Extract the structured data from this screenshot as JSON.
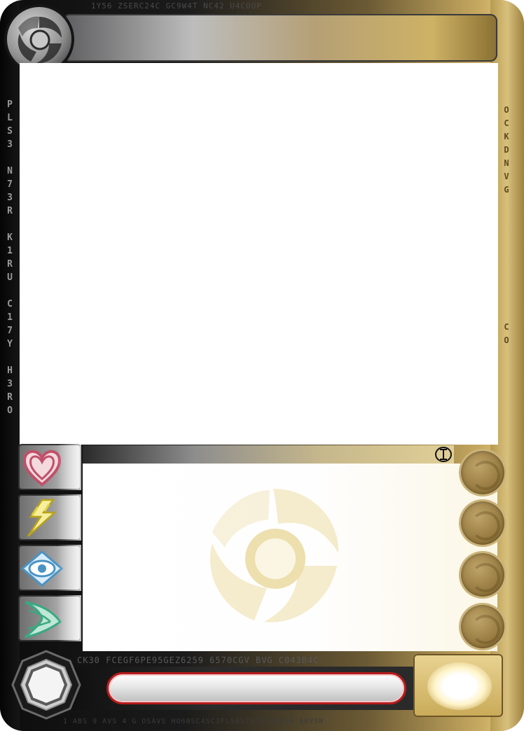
{
  "card": {
    "title": "",
    "type_line": "",
    "rules_text": "",
    "name": "",
    "type_icon": "roman-numeral-one-icon",
    "left_edge_code": "P\nL\nS\n3\n\nN\n7\n3\nR\n\nK\n1\nR\nU\n\nC\n1\n7\nY\n\nH\n3\nR\nO",
    "right_edge_code": "O\nC\nK\nD\nN\nV\nG",
    "right_edge_code_lower": "C\nO",
    "top_edge_code": "1Y56  ZSERC24C GC9W4T   NC42   U4COUP",
    "bottom_edge_code": "CK30 FCEGF6PE95GEZ6259 6570CGV BVG C043B4C",
    "bottom_edge_code_lower": "1 ABS 9 AVS 4 G OSAVS HO60SC4SCJFLS0S76ZSC460G0 A6VSN",
    "stat_icons": [
      "heart-icon",
      "lightning-icon",
      "eye-icon",
      "speed-arrow-icon"
    ],
    "round_slot_icons": [
      "swirl-icon",
      "swirl-icon",
      "swirl-icon",
      "swirl-icon"
    ],
    "colors": {
      "gold": "#c9ab61",
      "dark": "#1b1b1b",
      "name_border": "#b61b1b",
      "heart": "#c0506a",
      "lightning": "#e4d23c",
      "eye": "#4a93c4",
      "speed": "#3aa882"
    }
  }
}
